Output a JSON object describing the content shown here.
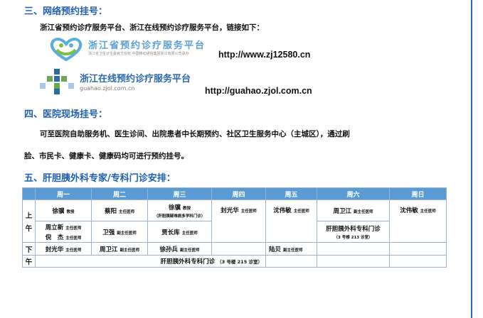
{
  "section3": {
    "title": "三、网络预约挂号：",
    "intro": "浙江省预约诊疗服务平台、浙江在线预约诊疗服务平台，链接如下：",
    "platform1": {
      "logo_title": "浙江省预约诊疗服务平台",
      "logo_sub": "浙江省卫生计生委官方授权   中国移动通信集团浙江有限公司承办",
      "url": "http://www.zj12580.cn"
    },
    "platform2": {
      "logo_title": "浙江在线预约诊疗服务平台",
      "logo_sub": "guahao.zjol.com.cn",
      "url": "http://guahao.zjol.com.cn"
    }
  },
  "section4": {
    "title": "四、医院现场挂号：",
    "line1": "可至医院自助服务机、医生诊间、出院患者中长期预约、社区卫生服务中心（主城区），通过刷",
    "line2": "脸、市民卡、健康卡、健康码均可进行预约挂号。"
  },
  "section5": {
    "title": "五、肝胆胰外科专家/专科门诊安排：",
    "days": [
      "周一",
      "周二",
      "周三",
      "周四",
      "周五",
      "周六",
      "周日"
    ],
    "morning_label": [
      "上",
      "午"
    ],
    "afternoon_label": [
      "下",
      "午"
    ],
    "morning": {
      "mon_a": {
        "name": "徐骥",
        "title": "教授"
      },
      "tue_a": {
        "name": "蔡阳",
        "title": "主任医师"
      },
      "wed_a": {
        "name": "徐骥",
        "title": "教授",
        "note": "（肝胆胰疑难病多学科门诊）"
      },
      "thu": {
        "name": "封光华",
        "title": "主任医师"
      },
      "fri": {
        "name": "沈伟敏",
        "title": "主任医师"
      },
      "sat_a": {
        "name": "周卫江",
        "title": "副主任医师"
      },
      "sun": {
        "name": "沈伟敏",
        "title": "主任医师"
      },
      "mon_b1": {
        "name": "周立新",
        "title": "主任医师"
      },
      "mon_b2": {
        "name": "倪　杰",
        "title": "主任医师"
      },
      "tue_b": {
        "name": "卫强",
        "title": "副主任医师"
      },
      "wed_b": {
        "name": "贾长库",
        "title": "主任医师"
      },
      "sat_b": {
        "name": "肝胆胰外科专科门诊",
        "note": "（3 号楼 213 诊室）"
      }
    },
    "afternoon": {
      "mon": {
        "name": "封光华",
        "title": "主任医师"
      },
      "tue": {
        "name": "周卫江",
        "title": "副主任医师"
      },
      "wed": {
        "name": "徐孙兵",
        "title": "副主任医师"
      },
      "fri": {
        "name": "陆贝",
        "title": "副主任医师"
      },
      "clinic": {
        "name": "肝胆胰外科专科门诊",
        "note": "（3 号楼 215 诊室）"
      }
    }
  }
}
